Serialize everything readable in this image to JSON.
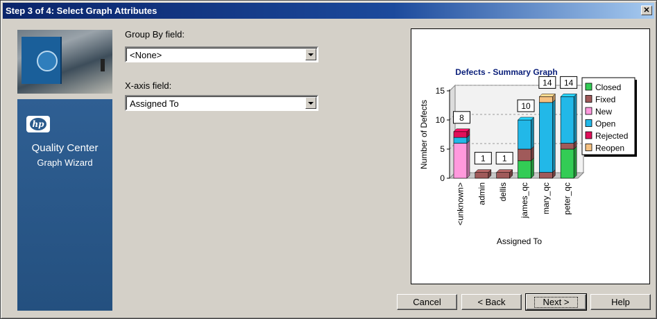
{
  "window": {
    "title": "Step 3 of 4: Select Graph Attributes",
    "close_glyph": "✕"
  },
  "banner": {
    "logo_text": "hp",
    "product": "Quality Center",
    "subtitle": "Graph Wizard"
  },
  "form": {
    "group_by": {
      "label": "Group By field:",
      "value": "<None>"
    },
    "x_axis": {
      "label": "X-axis field:",
      "value": "Assigned To"
    }
  },
  "buttons": {
    "cancel": "Cancel",
    "back": "< Back",
    "next": "Next >",
    "help": "Help"
  },
  "chart_data": {
    "type": "bar",
    "stacked": true,
    "title": "Defects - Summary Graph",
    "xlabel": "Assigned To",
    "ylabel": "Number of Defects",
    "ylim": [
      0,
      15
    ],
    "yticks": [
      0,
      5,
      10,
      15
    ],
    "grid": true,
    "legend_position": "right",
    "categories": [
      "<unknown>",
      "admin",
      "dellis",
      "james_qc",
      "mary_qc",
      "peter_qc"
    ],
    "totals": [
      8,
      1,
      1,
      10,
      14,
      14
    ],
    "series": [
      {
        "name": "Closed",
        "color": "#33cc55",
        "values": [
          0,
          0,
          0,
          3,
          0,
          5
        ]
      },
      {
        "name": "Fixed",
        "color": "#a05a5a",
        "values": [
          0,
          1,
          1,
          2,
          1,
          1
        ]
      },
      {
        "name": "New",
        "color": "#ff99dd",
        "values": [
          6,
          0,
          0,
          0,
          0,
          0
        ]
      },
      {
        "name": "Open",
        "color": "#22b8e8",
        "values": [
          1,
          0,
          0,
          5,
          12,
          8
        ]
      },
      {
        "name": "Rejected",
        "color": "#e0105a",
        "values": [
          1,
          0,
          0,
          0,
          0,
          0
        ]
      },
      {
        "name": "Reopen",
        "color": "#f5c080",
        "values": [
          0,
          0,
          0,
          0,
          1,
          0
        ]
      }
    ]
  }
}
